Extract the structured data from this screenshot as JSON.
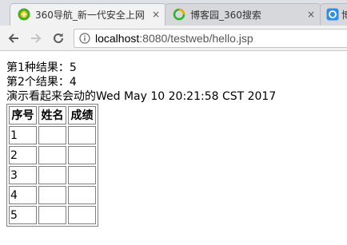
{
  "browser": {
    "tabs": [
      {
        "title": "360导航_新一代安全上网",
        "close": "×",
        "icon": "360-favicon"
      },
      {
        "title": "博客园_360搜索",
        "close": "×",
        "icon": "360-search-favicon"
      },
      {
        "title": "博",
        "icon": "blog-favicon"
      }
    ],
    "url": {
      "host": "localhost",
      "rest": ":8080/testweb/hello.jsp"
    }
  },
  "page": {
    "lines": [
      "第1种结果：5",
      "第2个结果：4",
      "演示看起来会动的Wed May 10 20:21:58 CST 2017"
    ],
    "table": {
      "headers": [
        "序号",
        "姓名",
        "成绩"
      ],
      "rows": [
        [
          "1",
          "",
          ""
        ],
        [
          "2",
          "",
          ""
        ],
        [
          "3",
          "",
          ""
        ],
        [
          "4",
          "",
          ""
        ],
        [
          "5",
          "",
          ""
        ]
      ]
    }
  }
}
